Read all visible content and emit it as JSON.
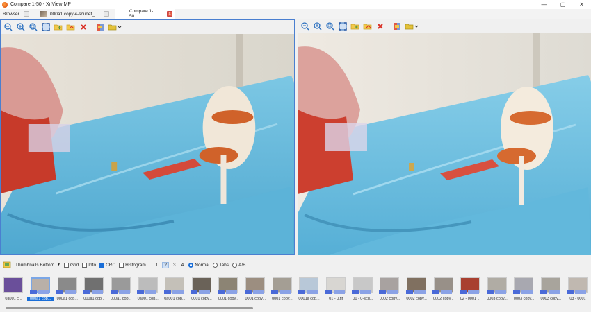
{
  "window": {
    "title": "Compare 1-50 - XnView MP",
    "minimize": "—",
    "maximize": "▢",
    "close": "✕"
  },
  "tabs": [
    {
      "label": "Browser"
    },
    {
      "label": "000a1 copy 4-scunet_..."
    },
    {
      "label": "Compare 1-50",
      "close": "x"
    }
  ],
  "toolbar_icons": [
    "zoom-out-icon",
    "zoom-in-icon",
    "zoom-fit-icon",
    "fullscreen-icon",
    "folder-open-icon",
    "folder-forward-icon",
    "delete-icon",
    "compare-icon",
    "folder-menu-icon"
  ],
  "thumb_options": {
    "view": "Thumbnails Bottom",
    "grid": "Grid",
    "info": "Info",
    "crc": "CRC",
    "histogram": "Histogram",
    "n1": "1",
    "n2": "2",
    "n3": "3",
    "n4": "4",
    "normal": "Normal",
    "tabs": "Tabs",
    "ab": "A/B"
  },
  "thumbnails": [
    "0a001 c...",
    "000a1 cop...",
    "000a1 cop...",
    "000a1 cop...",
    "000a1 cop...",
    "0a001 cop...",
    "0a001 cop...",
    "0001 copy...",
    "0001 copy...",
    "0001 copy...",
    "0001 copy...",
    "0001a cop...",
    "01 - 0.tif",
    "01 - 0-scu...",
    "0002 copy...",
    "0002 copy...",
    "0002 copy...",
    "02 - 0001 ...",
    "0003 copy...",
    "0003 copy...",
    "0003 copy...",
    "03 - 0001"
  ]
}
